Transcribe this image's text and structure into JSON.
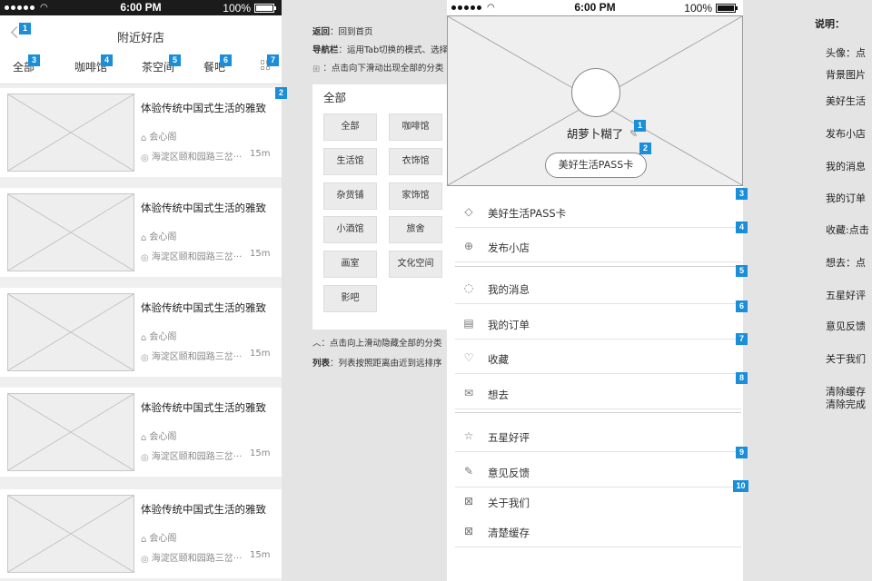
{
  "status": {
    "time": "6:00 PM",
    "battery": "100%"
  },
  "left_phone": {
    "title": "附近好店",
    "tabs": [
      "全部",
      "咖啡馆",
      "茶空间",
      "餐吧"
    ],
    "badges": [
      "1",
      "2",
      "3",
      "4",
      "5",
      "6",
      "7"
    ],
    "items": [
      {
        "name": "体验传统中国式生活的雅致",
        "shop": "会心阁",
        "address": "海淀区颐和园路三岔···",
        "distance": "15m"
      },
      {
        "name": "体验传统中国式生活的雅致",
        "shop": "会心阁",
        "address": "海淀区颐和园路三岔···",
        "distance": "15m"
      },
      {
        "name": "体验传统中国式生活的雅致",
        "shop": "会心阁",
        "address": "海淀区颐和园路三岔···",
        "distance": "15m"
      },
      {
        "name": "体验传统中国式生活的雅致",
        "shop": "会心阁",
        "address": "海淀区颐和园路三岔···",
        "distance": "15m"
      },
      {
        "name": "体验传统中国式生活的雅致",
        "shop": "会心阁",
        "address": "海淀区颐和园路三岔···",
        "distance": "15m"
      }
    ]
  },
  "middle_notes": {
    "back_label": "返回",
    "back_text": "：回到首页",
    "nav_label": "导航栏",
    "nav_text": "：运用Tab切换的模式、选择",
    "grid_text": "：点击向下滑动出现全部的分类",
    "category_panel_title": "全部",
    "categories": [
      "全部",
      "咖啡馆",
      "生活馆",
      "衣饰馆",
      "杂货铺",
      "家饰馆",
      "小酒馆",
      "旅舍",
      "画室",
      "文化空间",
      "影吧"
    ],
    "collapse_text": "︿：点击向上滑动隐藏全部的分类",
    "list_label": "列表",
    "list_text": "：列表按照距离由近到远排序"
  },
  "right_phone": {
    "username": "胡萝卜糊了",
    "pass_button": "美好生活PASS卡",
    "menu": [
      {
        "label": "美好生活PASS卡",
        "icon": "diamond-icon"
      },
      {
        "label": "发布小店",
        "icon": "plus-circle-icon"
      },
      {
        "label": "我的消息",
        "icon": "chat-icon"
      },
      {
        "label": "我的订单",
        "icon": "clipboard-icon"
      },
      {
        "label": "收藏",
        "icon": "heart-icon"
      },
      {
        "label": "想去",
        "icon": "envelope-icon"
      },
      {
        "label": "五星好评",
        "icon": "star-icon"
      },
      {
        "label": "意见反馈",
        "icon": "edit-icon"
      },
      {
        "label": "关于我们",
        "icon": "placeholder-icon"
      },
      {
        "label": "清楚缓存",
        "icon": "placeholder-icon"
      }
    ],
    "badges": [
      "1",
      "2",
      "3",
      "4",
      "5",
      "6",
      "7",
      "8",
      "9",
      "10"
    ]
  },
  "right_notes": {
    "title": "说明：",
    "lines": [
      "头像：点",
      "背景图片",
      "美好生活",
      "发布小店",
      "我的消息",
      "我的订单",
      "收藏:点击",
      "想去：点",
      "五星好评",
      "意见反馈",
      "关于我们",
      "清除缓存",
      "清除完成"
    ]
  },
  "colors": {
    "badge": "#1a8ed8",
    "status_dark": "#1b1b1b"
  }
}
